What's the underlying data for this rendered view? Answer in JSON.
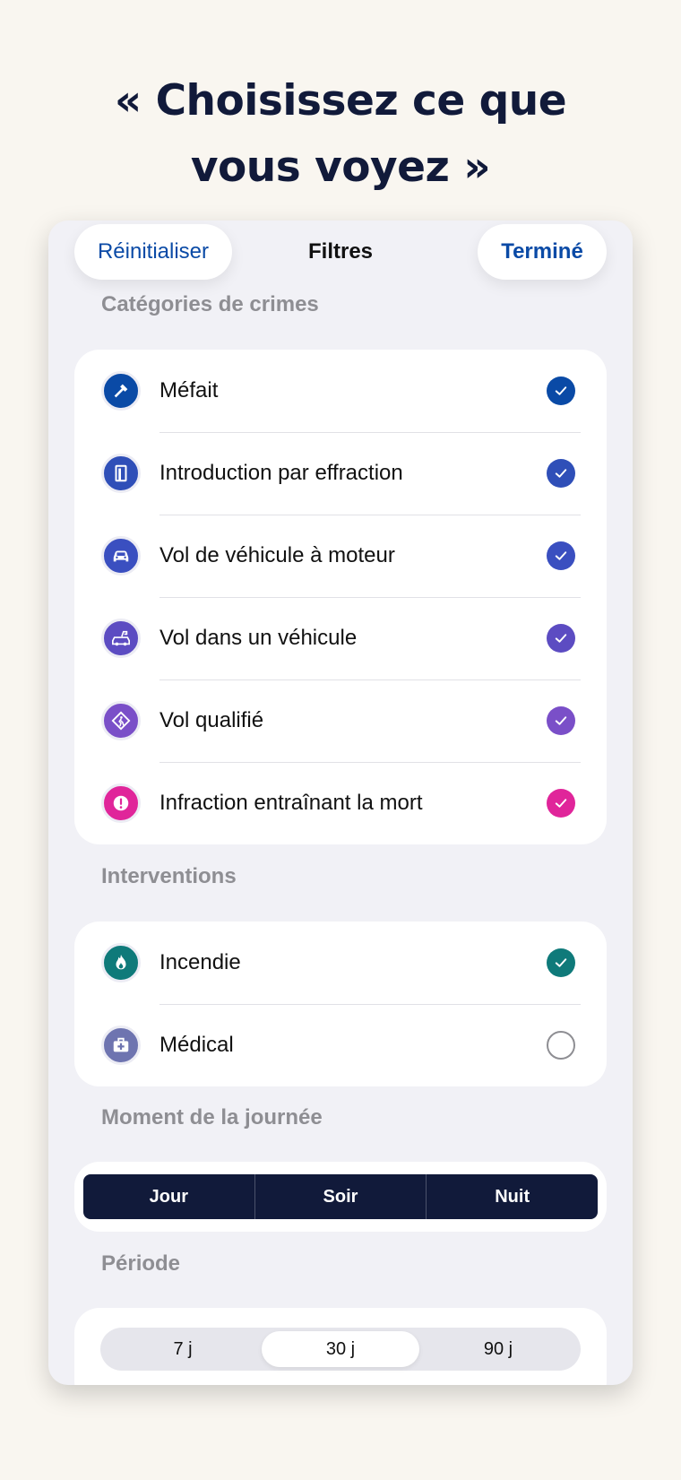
{
  "headline": {
    "line1": "« Choisissez ce que",
    "line2": "vous voyez »"
  },
  "sheet": {
    "reset_label": "Réinitialiser",
    "title": "Filtres",
    "done_label": "Terminé"
  },
  "crime_section": {
    "label": "Catégories de crimes",
    "items": [
      {
        "label": "Méfait",
        "icon": "hammer-icon",
        "color": "#0a4aa6",
        "checked": true
      },
      {
        "label": "Introduction par effraction",
        "icon": "door-icon",
        "color": "#2f4fb8",
        "checked": true
      },
      {
        "label": "Vol de véhicule à moteur",
        "icon": "car-icon",
        "color": "#3a4fc0",
        "checked": true
      },
      {
        "label": "Vol dans un véhicule",
        "icon": "car-breakin-icon",
        "color": "#5c4cc2",
        "checked": true
      },
      {
        "label": "Vol qualifié",
        "icon": "robbery-icon",
        "color": "#7a4fc8",
        "checked": true
      },
      {
        "label": "Infraction entraînant la mort",
        "icon": "alert-icon",
        "color": "#e0259a",
        "checked": true
      }
    ]
  },
  "interventions_section": {
    "label": "Interventions",
    "items": [
      {
        "label": "Incendie",
        "icon": "flame-icon",
        "color": "#0f7a7a",
        "checked": true
      },
      {
        "label": "Médical",
        "icon": "medical-kit-icon",
        "color": "#6e74b0",
        "checked": false
      }
    ]
  },
  "time_of_day": {
    "label": "Moment de la journée",
    "options": [
      "Jour",
      "Soir",
      "Nuit"
    ]
  },
  "period": {
    "label": "Période",
    "options": [
      "7 j",
      "30 j",
      "90 j"
    ],
    "selected": "30 j"
  },
  "colors": {
    "navy": "#111a3a",
    "link_blue": "#0a4aa6",
    "background": "#f9f6f0",
    "sheet_background": "#f1f1f6"
  }
}
